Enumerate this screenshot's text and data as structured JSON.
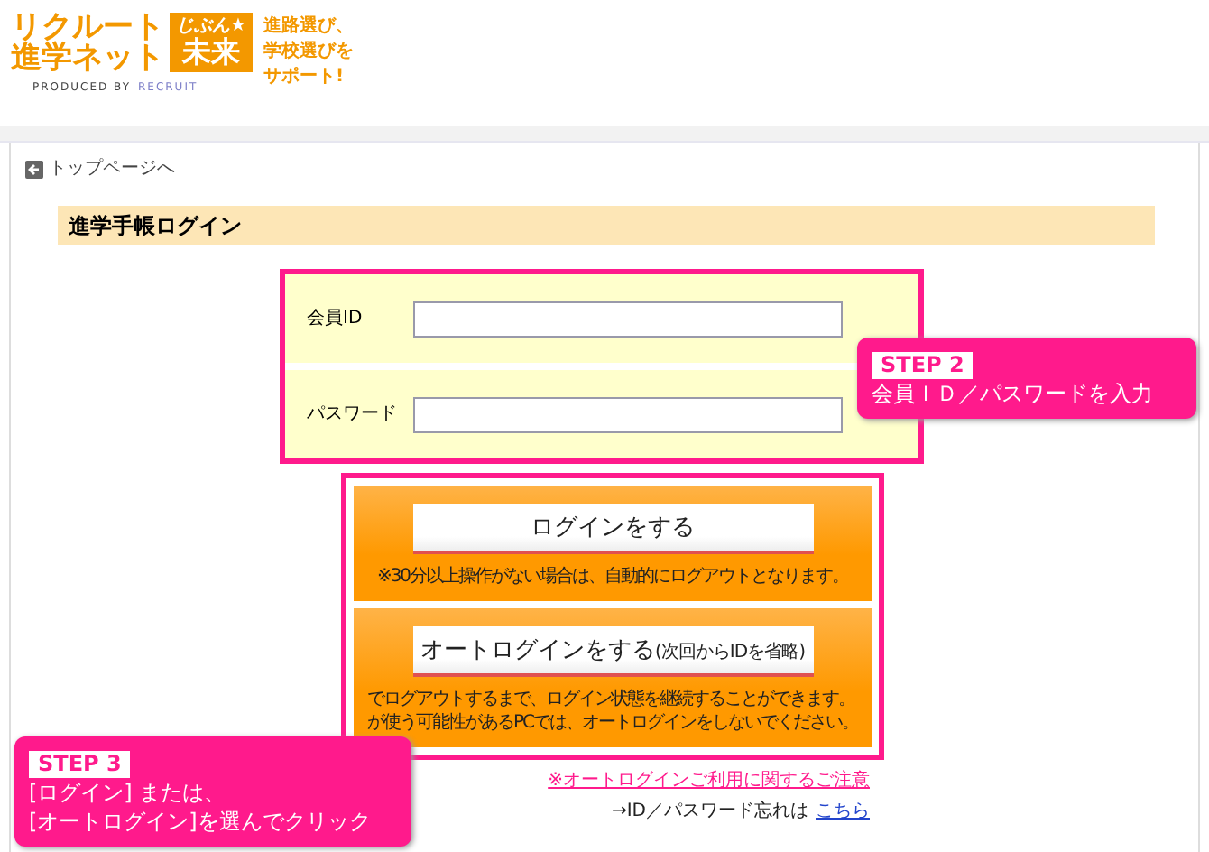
{
  "header": {
    "logo": {
      "line1": "リクルート",
      "line2": "進学ネット",
      "badge_top": "じぶん★",
      "badge_main": "未来",
      "producer": "PRODUCED BY",
      "brand": "RECRUIT"
    },
    "tagline": [
      "進路選び、",
      "学校選びを",
      "サポート!"
    ]
  },
  "back_link": "トップページへ",
  "page_title": "進学手帳ログイン",
  "fields": [
    {
      "label": "会員ID"
    },
    {
      "label": "パスワード"
    }
  ],
  "login_panels": [
    {
      "label": "ログインをする",
      "notes": [
        "※30分以上操作がない場合は、自動的にログアウトとなります。"
      ]
    },
    {
      "label": "オートログインをする",
      "hint": "(次回からIDを省略)",
      "notes": [
        "でログアウトするまで、ログイン状態を継続することができます。",
        "が使う可能性があるPCでは、オートログインをしないでください。"
      ]
    }
  ],
  "caution_link": "※オートログインご利用に関するご注意",
  "forgot": {
    "text": "→ID／パスワード忘れは",
    "link": "こちら"
  },
  "callouts": [
    {
      "step": "STEP 2",
      "lines": [
        "会員ＩＤ／パスワードを入力"
      ]
    },
    {
      "step": "STEP 3",
      "lines": [
        "[ログイン] または、",
        "[オートログイン]を選んでクリック"
      ]
    }
  ]
}
